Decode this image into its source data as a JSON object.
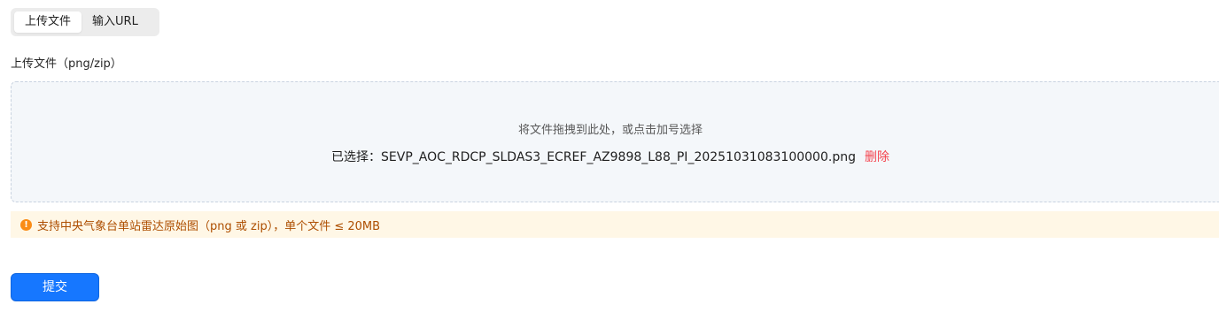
{
  "tabs": [
    {
      "label": "上传文件",
      "active": true
    },
    {
      "label": "输入URL",
      "active": false
    }
  ],
  "upload": {
    "label": "上传文件（png/zip）",
    "hint": "将文件拖拽到此处，或点击加号选择",
    "selected_prefix": "已选择：",
    "selected_file": "SEVP_AOC_RDCP_SLDAS3_ECREF_AZ9898_L88_PI_20251031083100000.png",
    "delete_label": "删除"
  },
  "notice": {
    "icon": "exclamation-circle-icon",
    "text": "支持中央气象台单站雷达原始图（png 或 zip），单个文件 ≤ 20MB"
  },
  "submit": {
    "label": "提交"
  },
  "colors": {
    "primary": "#1677ff",
    "danger": "#f5444e",
    "warning_bg": "#fff7e6",
    "warning_text": "#ad4e00",
    "warning_icon": "#fa8c16"
  }
}
